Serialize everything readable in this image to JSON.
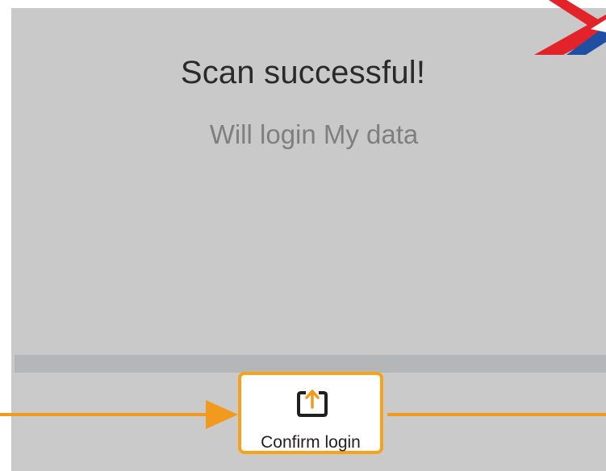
{
  "dialog": {
    "title": "Scan successful!",
    "subtitle": "Will login My data"
  },
  "confirm": {
    "label": "Confirm login",
    "icon": "upload-arrow-icon"
  },
  "colors": {
    "screen_bg": "#c8c9c8",
    "accent_orange": "#f29a1d",
    "logo_red": "#e2232a",
    "logo_blue": "#1f4fa3"
  }
}
